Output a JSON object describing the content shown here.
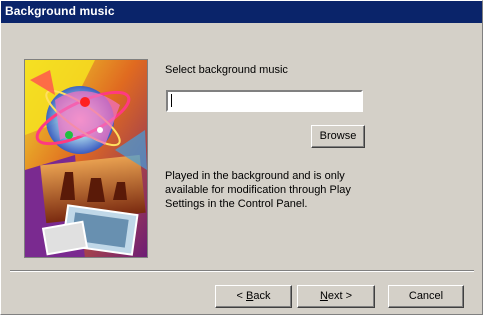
{
  "window": {
    "title": "Background music"
  },
  "content": {
    "prompt": "Select background music",
    "music_value": "",
    "browse_label": "Browse",
    "description": "Played in the background and is only\navailable for modification through Play\nSettings in the Control Panel."
  },
  "footer": {
    "back_prefix": "< ",
    "back_mnemonic": "B",
    "back_rest": "ack",
    "next_mnemonic": "N",
    "next_rest": "ext >",
    "cancel_label": "Cancel"
  },
  "colors": {
    "titlebar": "#0a246a",
    "face": "#d4d0c8"
  }
}
